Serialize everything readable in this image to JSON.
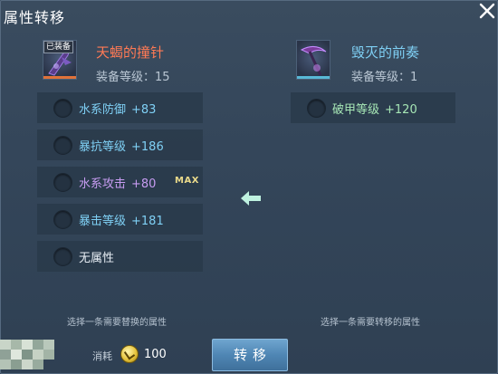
{
  "window": {
    "title": "属性转移"
  },
  "colors": {
    "source_name": "#ff7a55",
    "target_name": "#7fd0f5",
    "water_attr": "#7fd0f5",
    "crit_attr": "#7fd0f5",
    "water_attack_attr": "#c79cf2",
    "none_attr": "#e8eef5",
    "target_attr": "#a6e6b5",
    "arrow": "#bff2e0",
    "source_underline": "#e0723a",
    "target_underline": "#58b8d6"
  },
  "source_equip": {
    "tag": "已装备",
    "name": "天蝎的撞针",
    "level_label": "装备等级：15",
    "icon": "scorpion-needle-weapon-icon"
  },
  "target_equip": {
    "name": "毁灭的前奏",
    "level_label": "装备等级：1",
    "icon": "scythe-weapon-icon"
  },
  "source_attrs": [
    {
      "name": "水系防御",
      "value": "+83",
      "max": ""
    },
    {
      "name": "暴抗等级",
      "value": "+186",
      "max": ""
    },
    {
      "name": "水系攻击",
      "value": "+80",
      "max": "MAX"
    },
    {
      "name": "暴击等级",
      "value": "+181",
      "max": ""
    },
    {
      "name": "无属性",
      "value": "",
      "max": ""
    }
  ],
  "target_attrs": [
    {
      "name": "破甲等级",
      "value": "+120"
    }
  ],
  "hints": {
    "left": "选择一条需要替换的属性",
    "right": "选择一条需要转移的属性"
  },
  "cost": {
    "label": "消耗",
    "icon": "gold-coin-icon",
    "value": "100"
  },
  "buttons": {
    "transfer": "转移"
  }
}
